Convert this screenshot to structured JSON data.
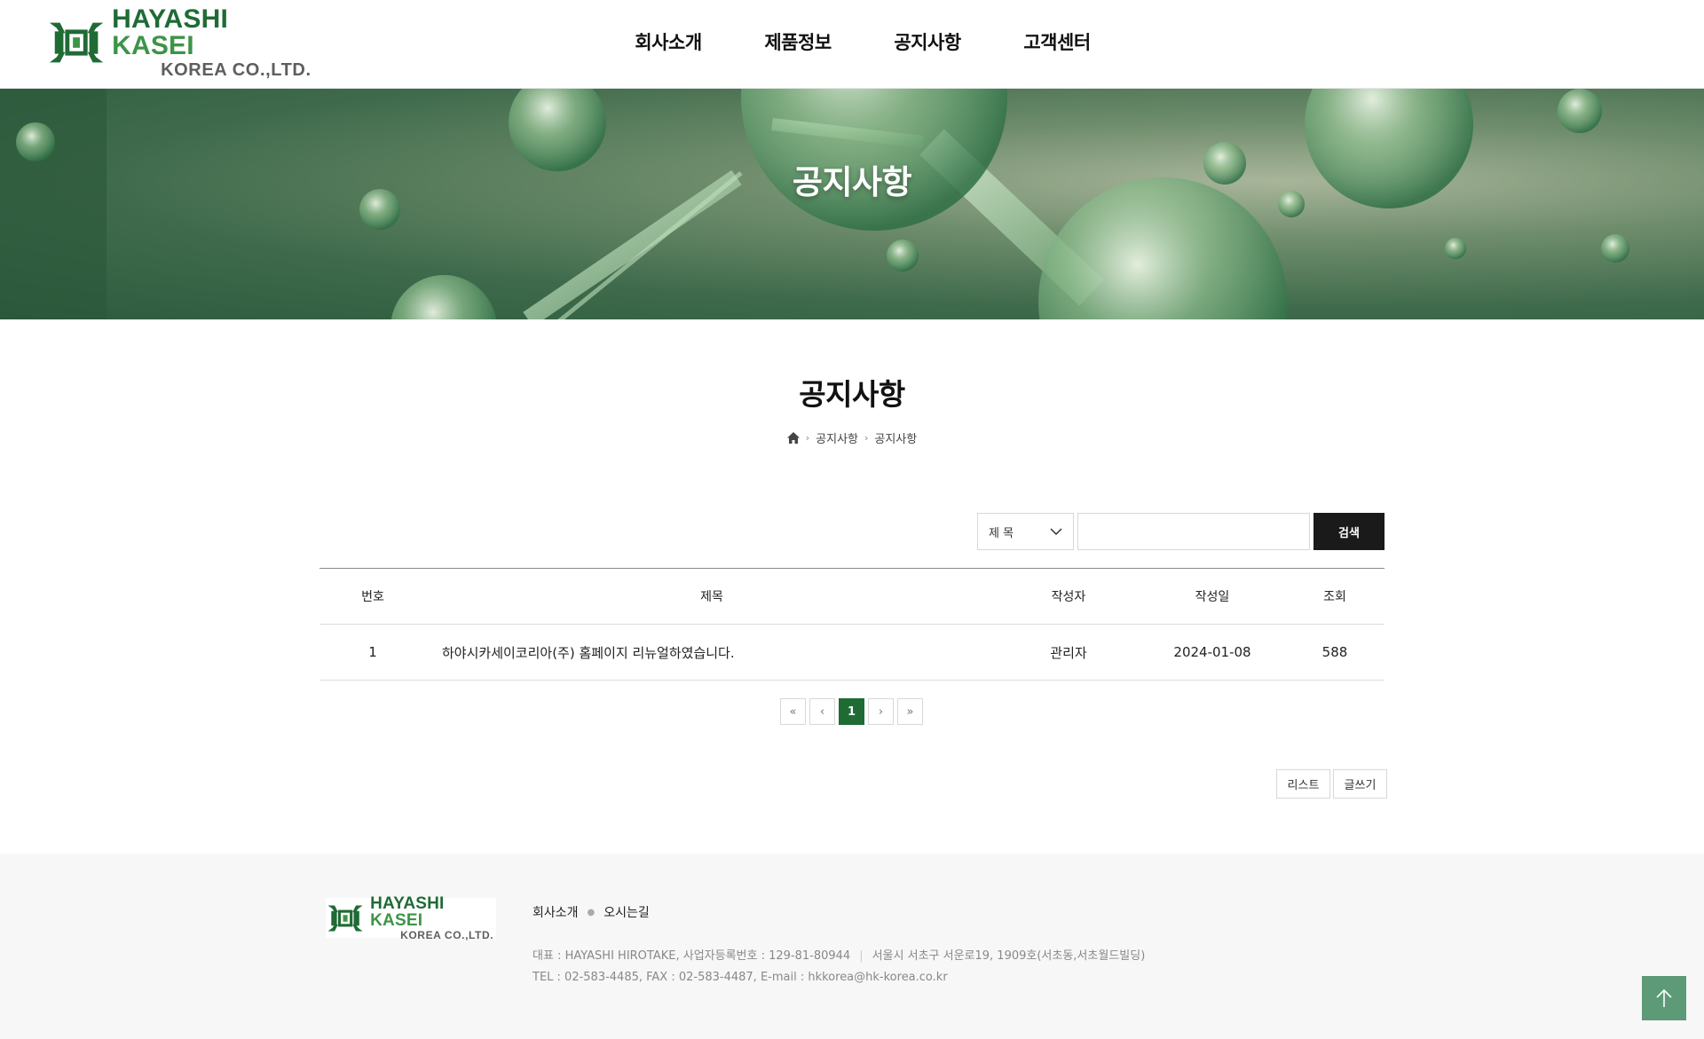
{
  "header": {
    "logo_line1_a": "HAYASHI ",
    "logo_line1_b": "KASEI",
    "logo_line2": "KOREA CO.,LTD.",
    "nav": [
      "회사소개",
      "제품정보",
      "공지사항",
      "고객센터"
    ]
  },
  "banner": {
    "title": "공지사항"
  },
  "page": {
    "title": "공지사항",
    "breadcrumb": [
      "공지사항",
      "공지사항"
    ]
  },
  "search": {
    "field_selected": "제 목",
    "query_value": "",
    "button_label": "검색"
  },
  "board": {
    "columns": [
      "번호",
      "제목",
      "작성자",
      "작성일",
      "조회"
    ],
    "rows": [
      {
        "no": "1",
        "subject": "하야시카세이코리아(주) 홈페이지 리뉴얼하였습니다.",
        "author": "관리자",
        "date": "2024-01-08",
        "views": "588"
      }
    ]
  },
  "pagination": {
    "first": "«",
    "prev": "‹",
    "current": "1",
    "next": "›",
    "last": "»"
  },
  "actions": {
    "list_label": "리스트",
    "write_label": "글쓰기"
  },
  "footer": {
    "logo_line1_a": "HAYASHI ",
    "logo_line1_b": "KASEI",
    "logo_line2": "KOREA CO.,LTD.",
    "links": [
      "회사소개",
      "오시는길"
    ],
    "info_line1_a": "대표 : HAYASHI HIROTAKE, 사업자등록번호 : 129-81-80944",
    "info_line1_b": "서울시 서초구 서운로19, 1909호(서초동,서초월드빌딩)",
    "info_line2": "TEL : 02-583-4485, FAX : 02-583-4487, E-mail : hkkorea@hk-korea.co.kr"
  },
  "colors": {
    "brand_green": "#1f6b35",
    "accent_green": "#3d9447",
    "top_button": "#5d9a77"
  }
}
